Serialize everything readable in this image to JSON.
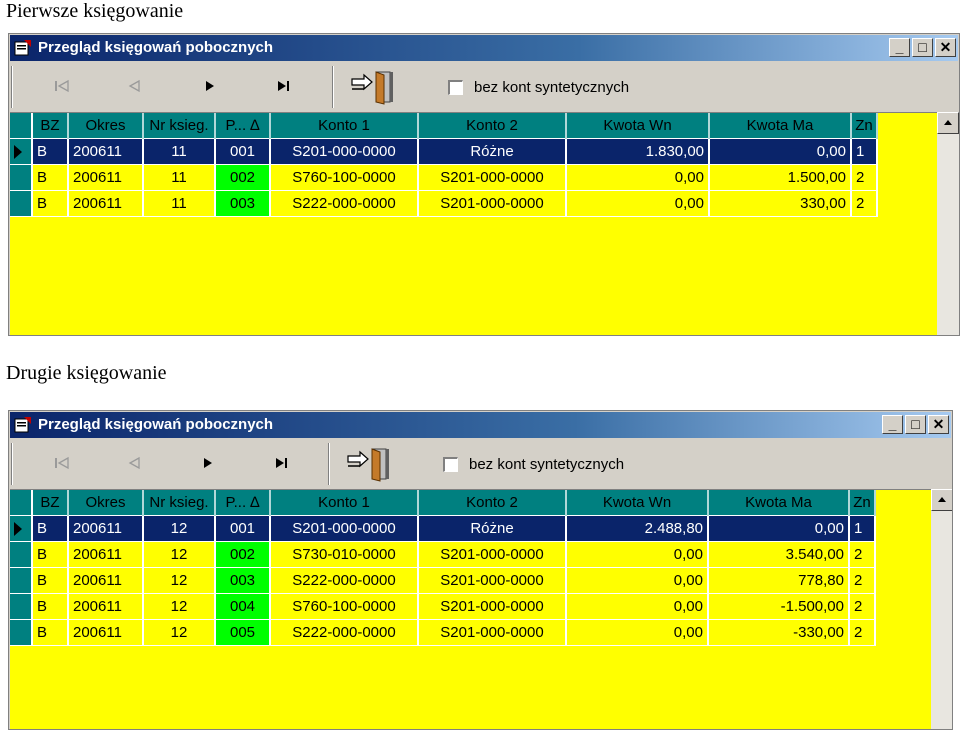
{
  "captions": [
    "Pierwsze księgowanie",
    "Drugie księgowanie"
  ],
  "window_title": "Przegląd księgowań pobocznych",
  "checkbox_label": "bez kont syntetycznych",
  "columns": [
    "BZ",
    "Okres",
    "Nr ksieg.",
    "P... ∆",
    "Konto 1",
    "Konto 2",
    "Kwota Wn",
    "Kwota Ma",
    "Zn"
  ],
  "colors": {
    "grid_bg": "#ffff00",
    "header_bg": "#008080",
    "selected_row": "#0a246a",
    "p_cell": "#00ff00"
  },
  "icons": [
    "first-record-icon",
    "prev-record-icon",
    "next-record-icon",
    "last-record-icon",
    "exit-door-icon"
  ],
  "grid1": {
    "rows": [
      [
        "B",
        "200611",
        "11",
        "001",
        "S201-000-0000",
        "Różne",
        "1.830,00",
        "0,00",
        "1"
      ],
      [
        "B",
        "200611",
        "11",
        "002",
        "S760-100-0000",
        "S201-000-0000",
        "0,00",
        "1.500,00",
        "2"
      ],
      [
        "B",
        "200611",
        "11",
        "003",
        "S222-000-0000",
        "S201-000-0000",
        "0,00",
        "330,00",
        "2"
      ]
    ]
  },
  "grid2": {
    "rows": [
      [
        "B",
        "200611",
        "12",
        "001",
        "S201-000-0000",
        "Różne",
        "2.488,80",
        "0,00",
        "1"
      ],
      [
        "B",
        "200611",
        "12",
        "002",
        "S730-010-0000",
        "S201-000-0000",
        "0,00",
        "3.540,00",
        "2"
      ],
      [
        "B",
        "200611",
        "12",
        "003",
        "S222-000-0000",
        "S201-000-0000",
        "0,00",
        "778,80",
        "2"
      ],
      [
        "B",
        "200611",
        "12",
        "004",
        "S760-100-0000",
        "S201-000-0000",
        "0,00",
        "-1.500,00",
        "2"
      ],
      [
        "B",
        "200611",
        "12",
        "005",
        "S222-000-0000",
        "S201-000-0000",
        "0,00",
        "-330,00",
        "2"
      ]
    ]
  }
}
